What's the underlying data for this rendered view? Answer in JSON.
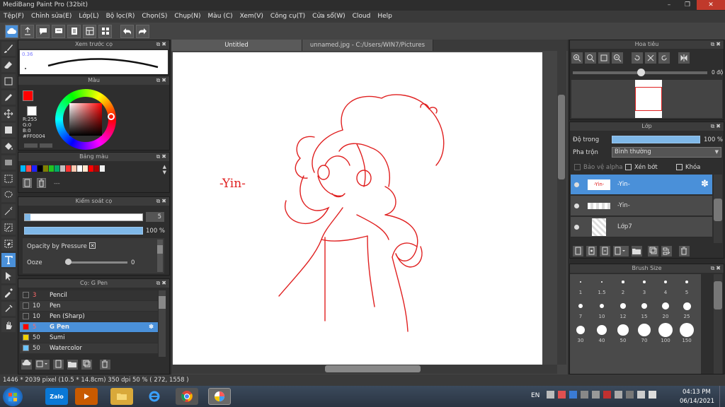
{
  "app": {
    "title": "MediBang Paint Pro (32bit)",
    "window_controls": [
      "–",
      "❐",
      "✕"
    ]
  },
  "menu": [
    "Tệp(F)",
    "Chỉnh sửa(E)",
    "Lớp(L)",
    "Bộ lọc(R)",
    "Chọn(S)",
    "Chụp(N)",
    "Màu (C)",
    "Xem(V)",
    "Công cụ(T)",
    "Cửa sổ(W)",
    "Cloud",
    "Help"
  ],
  "panels": {
    "preview": {
      "title": "Xem trước cọ",
      "size_value": "0.36"
    },
    "color": {
      "title": "Màu",
      "r": "R:255",
      "g": "G:0",
      "b": "B:0",
      "hex": "#FF0004",
      "primary_color": "#ff0000"
    },
    "palette": {
      "title": "Bảng màu",
      "swatches": [
        "#00b7ff",
        "#ff4d4d",
        "#2020ff",
        "#000000",
        "#808000",
        "#22c422",
        "#00aa66",
        "#c0c0c0",
        "#ff3030",
        "#ffc9b0",
        "#ffffff",
        "#ffe6cc",
        "#ff0000",
        "#b00000",
        "#f0f0f0"
      ],
      "more": "---"
    },
    "brush_control": {
      "title": "Kiểm soát cọ",
      "size_value": "5",
      "size_fraction": 0.05,
      "opacity_value": "100 %",
      "opacity_fraction": 1.0,
      "opacity_pressure_label": "Opacity by Pressure",
      "ooze_label": "Ooze",
      "ooze_value": "0"
    },
    "brush_list": {
      "title": "Cọ: G Pen",
      "items": [
        {
          "size": "3",
          "name": "Pencil",
          "color": "#333333"
        },
        {
          "size": "10",
          "name": "Pen",
          "color": "#333333"
        },
        {
          "size": "10",
          "name": "Pen (Sharp)",
          "color": "#333333"
        },
        {
          "size": "5",
          "name": "G Pen",
          "color": "#ff0000",
          "selected": true
        },
        {
          "size": "50",
          "name": "Sumi",
          "color": "#f0d000"
        },
        {
          "size": "50",
          "name": "Watercolor",
          "color": "#6cc4ff"
        }
      ]
    },
    "navigator": {
      "title": "Hoa tiêu",
      "angle": "0 độ"
    },
    "layers": {
      "title": "Lớp",
      "opacity_label": "Độ trong",
      "opacity_value": "100 %",
      "opacity_fraction": 1.0,
      "blend_label": "Pha trộn",
      "blend_value": "Bình thường",
      "protect_alpha": "Bảo vệ alpha",
      "clipping": "Xén bớt",
      "lock": "Khóa",
      "items": [
        {
          "name": "-Yin-",
          "thumb_text": "-Yin-",
          "selected": true
        },
        {
          "name": "-Yin-",
          "thumb_text": "",
          "selected": false
        },
        {
          "name": "Lớp7",
          "thumb_text": "",
          "selected": false
        }
      ]
    },
    "brush_size": {
      "title": "Brush Size",
      "sizes": [
        "1",
        "1.5",
        "2",
        "3",
        "4",
        "5",
        "7",
        "10",
        "12",
        "15",
        "20",
        "25",
        "30",
        "40",
        "50",
        "70",
        "100",
        "150"
      ]
    }
  },
  "tabs": [
    {
      "label": "Untitled",
      "active": true
    },
    {
      "label": "unnamed.jpg - C:/Users/WIN7/Pictures",
      "active": false
    }
  ],
  "canvas": {
    "text_label": "-Yin-",
    "stroke_color": "#e02020"
  },
  "status": {
    "text": "1446 * 2039 pixel  (10.5 * 14.8cm)  350 dpi  50 %  ( 272, 1558 )"
  },
  "taskbar": {
    "lang": "EN",
    "time": "04:13 PM",
    "date": "06/14/2021",
    "zalo_label": "Zalo"
  }
}
